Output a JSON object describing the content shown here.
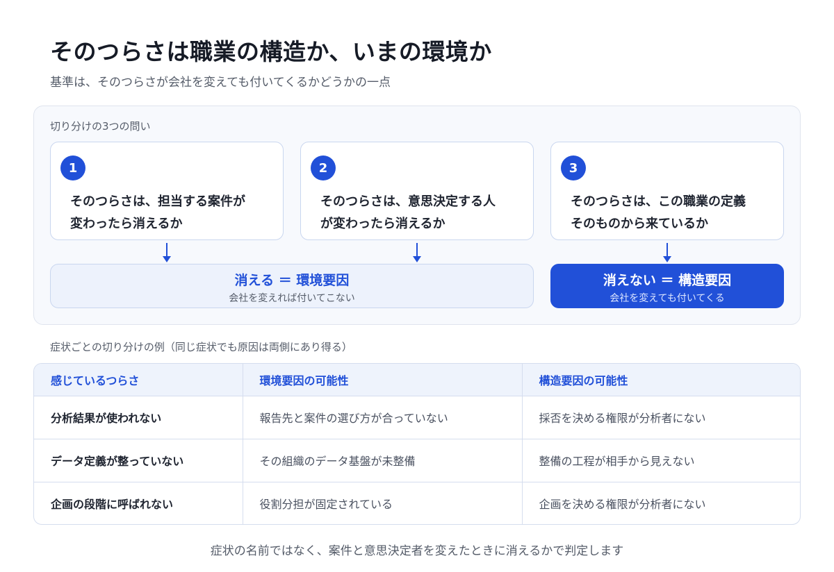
{
  "title": "そのつらさは職業の構造か、いまの環境か",
  "subtitle": "基準は、そのつらさが会社を変えても付いてくるかどうかの一点",
  "questions_panel": {
    "label": "切り分けの3つの問い",
    "questions": [
      {
        "number": "1",
        "text": "そのつらさは、担当する案件が\n変わったら消えるか"
      },
      {
        "number": "2",
        "text": "そのつらさは、意思決定する人\nが変わったら消えるか"
      },
      {
        "number": "3",
        "text": "そのつらさは、この職業の定義\nそのものから来ているか"
      }
    ],
    "results": {
      "environmental": {
        "main": "消える ＝ 環境要因",
        "sub": "会社を変えれば付いてこない"
      },
      "structural": {
        "main": "消えない ＝ 構造要因",
        "sub": "会社を変えても付いてくる"
      }
    }
  },
  "examples": {
    "label": "症状ごとの切り分けの例（同じ症状でも原因は両側にあり得る）",
    "headers": [
      "感じているつらさ",
      "環境要因の可能性",
      "構造要因の可能性"
    ],
    "rows": [
      [
        "分析結果が使われない",
        "報告先と案件の選び方が合っていない",
        "採否を決める権限が分析者にない"
      ],
      [
        "データ定義が整っていない",
        "その組織のデータ基盤が未整備",
        "整備の工程が相手から見えない"
      ],
      [
        "企画の段階に呼ばれない",
        "役割分担が固定されている",
        "企画を決める権限が分析者にない"
      ]
    ]
  },
  "footer": "症状の名前ではなく、案件と意思決定者を変えたときに消えるかで判定します",
  "colors": {
    "accent": "#2150d8",
    "panel_bg": "#f7f9fd",
    "border": "#c9d6ef"
  }
}
